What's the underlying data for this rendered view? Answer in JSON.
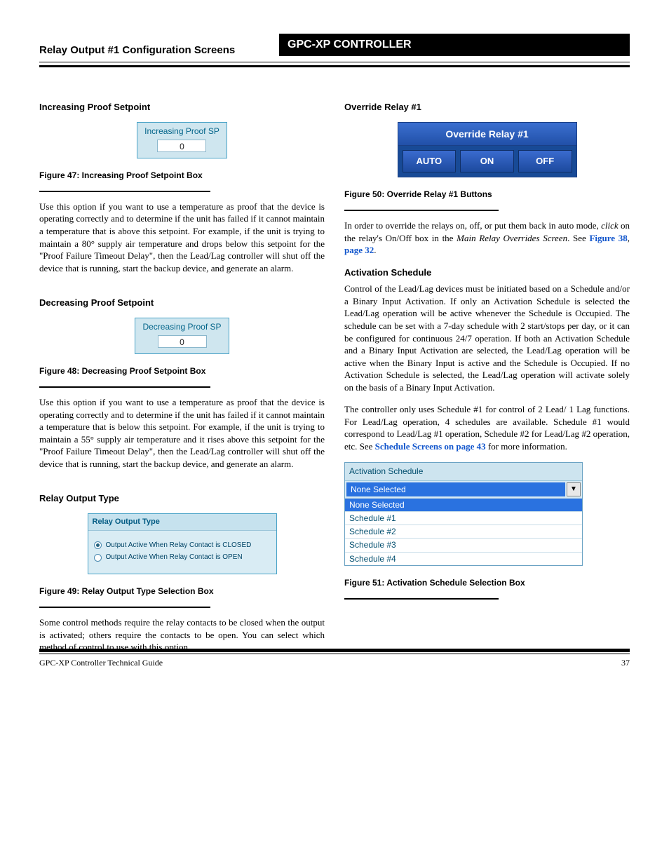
{
  "header": {
    "black_title": "GPC-XP CONTROLLER",
    "white_title": "Relay Output #1 Configuration Screens"
  },
  "left": {
    "s1": {
      "title": "Increasing Proof Setpoint",
      "panel_label": "Increasing Proof SP",
      "panel_value": "0",
      "caption": "Figure 47: Increasing Proof Setpoint Box",
      "body": "Use this option if you want to use a temperature as proof that the device is operating correctly and to determine if the unit has failed if it cannot maintain a temperature that is above this setpoint. For example, if the unit is trying to maintain a 80° supply air temperature and drops below this setpoint for the \"Proof Failure Timeout Delay\", then the Lead/Lag controller will shut off the device that is running, start the backup device, and generate an alarm."
    },
    "s2": {
      "title": "Decreasing Proof Setpoint",
      "panel_label": "Decreasing Proof SP",
      "panel_value": "0",
      "caption": "Figure 48: Decreasing Proof Setpoint Box",
      "body": "Use this option if you want to use a temperature as proof that the device is operating correctly and to determine if the unit has failed if it cannot maintain a temperature that is below this setpoint. For example, if the unit is trying to maintain a 55° supply air temperature and it rises above this setpoint for the \"Proof Failure Timeout Delay\", then the Lead/Lag controller will shut off the device that is running, start the backup device, and generate an alarm."
    },
    "s3": {
      "title": "Relay Output Type",
      "panel_head": "Relay Output Type",
      "opt1": "Output Active When Relay Contact is CLOSED",
      "opt2": "Output Active When Relay Contact is OPEN",
      "caption": "Figure 49: Relay Output Type Selection Box",
      "body": "Some control methods require the relay contacts to be closed when the output is activated; others require the contacts to be open. You can select which method of control to use with this option."
    }
  },
  "right": {
    "s4": {
      "title": "Override Relay #1",
      "ov_title": "Override Relay #1",
      "btn_auto": "AUTO",
      "btn_on": "ON",
      "btn_off": "OFF",
      "caption": "Figure 50: Override Relay #1 Buttons",
      "body_pre": "In order to override the relays on, off, or put them back in auto mode, ",
      "body_click": "click",
      "body_mid": " on the relay's On/Off box in the ",
      "body_em1": "Main Relay Overrides Screen",
      "body_after1": ". See ",
      "body_link1": "Figure 38",
      "body_comma": ", ",
      "body_link2": "page 32",
      "body_period": "."
    },
    "s5": {
      "title": "Activation Schedule",
      "para1": "Control of the Lead/Lag devices must be initiated based on a Schedule and/or a Binary Input Activation.  If only an Activation Schedule is selected the Lead/Lag operation will be active whenever the Schedule is Occupied. The schedule can be set with a 7-day schedule with 2 start/stops per day, or it can be configured for continuous 24/7 operation. If both an Activation Schedule and a Binary Input Activation are selected, the Lead/Lag operation will be active when the Binary Input is active and the Schedule is Occupied. If no Activation Schedule is selected, the Lead/Lag operation will activate solely on the basis of a Binary Input Activation.",
      "para2_pre": "The controller only uses Schedule #1 for control of 2 Lead/ 1 Lag functions. For Lead/Lag operation, 4 schedules are available. Schedule #1 would correspond to Lead/Lag #1 operation, Schedule #2 for Lead/Lag #2 operation, etc. See ",
      "para2_link": "Schedule Screens on page 43",
      "para2_post": " for more information.",
      "sched_head": "Activation Schedule",
      "sched_selected": "None Selected",
      "opts": [
        "None Selected",
        "Schedule #1",
        "Schedule #2",
        "Schedule #3",
        "Schedule #4"
      ],
      "caption": "Figure 51: Activation Schedule Selection Box"
    }
  },
  "footer": {
    "left": "GPC-XP Controller Technical Guide",
    "right": "37"
  }
}
